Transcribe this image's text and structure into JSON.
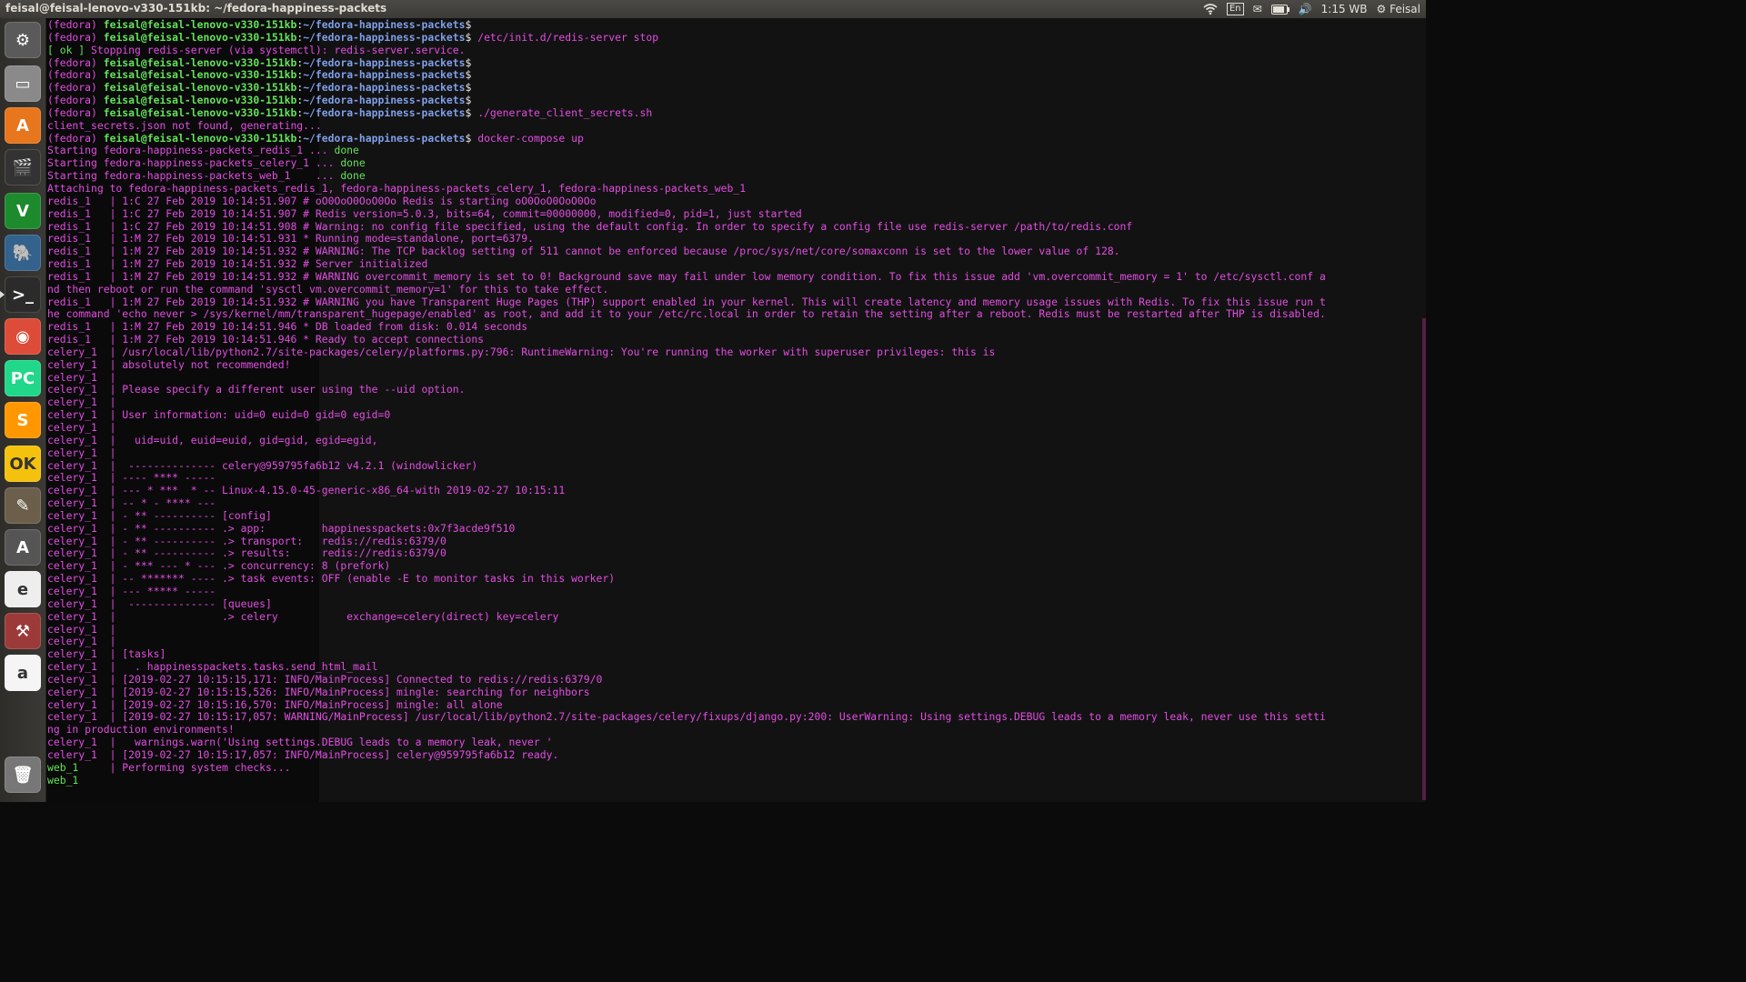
{
  "window_title": "feisal@feisal-lenovo-v330-151kb: ~/fedora-happiness-packets",
  "indicators": {
    "lang": "En",
    "clock": "1:15 WB",
    "user": "Feisal"
  },
  "launcher": [
    {
      "name": "system-settings-icon",
      "glyph": "⚙",
      "bg": "#5a5a5a"
    },
    {
      "name": "files-icon",
      "glyph": "▭",
      "bg": "#8a8a8a"
    },
    {
      "name": "software-center-icon",
      "glyph": "A",
      "bg": "#e8761d"
    },
    {
      "name": "video-editor-icon",
      "glyph": "🎬",
      "bg": "#333333"
    },
    {
      "name": "vim-icon",
      "glyph": "V",
      "bg": "#1e8a2e"
    },
    {
      "name": "postgres-icon",
      "glyph": "🐘",
      "bg": "#33628c"
    },
    {
      "name": "terminal-icon",
      "glyph": ">_",
      "bg": "#2b2b2b",
      "active": true
    },
    {
      "name": "chrome-icon",
      "glyph": "◉",
      "bg": "#dd4b39"
    },
    {
      "name": "pycharm-icon",
      "glyph": "PC",
      "bg": "#21d789"
    },
    {
      "name": "sublime-icon",
      "glyph": "S",
      "bg": "#ff9800"
    },
    {
      "name": "badge-app-icon",
      "glyph": "OK",
      "bg": "#f4c20d"
    },
    {
      "name": "gimp-icon",
      "glyph": "✎",
      "bg": "#6b5e4b"
    },
    {
      "name": "update-manager-icon",
      "glyph": "A",
      "bg": "#555555"
    },
    {
      "name": "email-icon",
      "glyph": "e",
      "bg": "#eeeeee"
    },
    {
      "name": "tools-icon",
      "glyph": "⚒",
      "bg": "#9c3a3a"
    },
    {
      "name": "amazon-icon",
      "glyph": "a",
      "bg": "#f5f5f5"
    },
    {
      "name": "trash-icon",
      "glyph": "🗑",
      "bg": "#777777"
    }
  ],
  "prompt": {
    "env": "(fedora) ",
    "user": "feisal@feisal-lenovo-v330-151kb",
    "sep": ":",
    "path": "~/fedora-happiness-packets",
    "sym": "$ "
  },
  "lines": [
    {
      "t": "prompt",
      "cmd": ""
    },
    {
      "t": "prompt",
      "cmd": "/etc/init.d/redis-server stop"
    },
    {
      "t": "text",
      "parts": [
        [
          "ok",
          "[ ok ]"
        ],
        [
          "red",
          " Stopping redis-server (via systemctl): redis-server.service."
        ]
      ]
    },
    {
      "t": "prompt",
      "cmd": ""
    },
    {
      "t": "prompt",
      "cmd": ""
    },
    {
      "t": "prompt",
      "cmd": ""
    },
    {
      "t": "prompt",
      "cmd": ""
    },
    {
      "t": "prompt",
      "cmd": "./generate_client_secrets.sh"
    },
    {
      "t": "text",
      "parts": [
        [
          "red",
          "client_secrets.json not found, generating..."
        ]
      ]
    },
    {
      "t": "prompt",
      "cmd": "docker-compose up"
    },
    {
      "t": "text",
      "parts": [
        [
          "red",
          "Starting fedora-happiness-packets_redis_1 ... "
        ],
        [
          "done",
          "done"
        ]
      ]
    },
    {
      "t": "text",
      "parts": [
        [
          "red",
          "Starting fedora-happiness-packets_celery_1 ... "
        ],
        [
          "done",
          "done"
        ]
      ]
    },
    {
      "t": "text",
      "parts": [
        [
          "red",
          "Starting fedora-happiness-packets_web_1    ... "
        ],
        [
          "done",
          "done"
        ]
      ]
    },
    {
      "t": "text",
      "parts": [
        [
          "red",
          "Attaching to fedora-happiness-packets_redis_1, fedora-happiness-packets_celery_1, fedora-happiness-packets_web_1"
        ]
      ]
    },
    {
      "t": "text",
      "parts": [
        [
          "red",
          "redis_1   | 1:C 27 Feb 2019 10:14:51.907 # oO0OoO0OoO0Oo Redis is starting oO0OoO0OoO0Oo"
        ]
      ]
    },
    {
      "t": "text",
      "parts": [
        [
          "red",
          "redis_1   | 1:C 27 Feb 2019 10:14:51.907 # Redis version=5.0.3, bits=64, commit=00000000, modified=0, pid=1, just started"
        ]
      ]
    },
    {
      "t": "text",
      "parts": [
        [
          "red",
          "redis_1   | 1:C 27 Feb 2019 10:14:51.908 # Warning: no config file specified, using the default config. In order to specify a config file use redis-server /path/to/redis.conf"
        ]
      ]
    },
    {
      "t": "text",
      "parts": [
        [
          "red",
          "redis_1   | 1:M 27 Feb 2019 10:14:51.931 * Running mode=standalone, port=6379."
        ]
      ]
    },
    {
      "t": "text",
      "parts": [
        [
          "red",
          "redis_1   | 1:M 27 Feb 2019 10:14:51.932 # WARNING: The TCP backlog setting of 511 cannot be enforced because /proc/sys/net/core/somaxconn is set to the lower value of 128."
        ]
      ]
    },
    {
      "t": "text",
      "parts": [
        [
          "red",
          "redis_1   | 1:M 27 Feb 2019 10:14:51.932 # Server initialized"
        ]
      ]
    },
    {
      "t": "text",
      "parts": [
        [
          "red",
          "redis_1   | 1:M 27 Feb 2019 10:14:51.932 # WARNING overcommit_memory is set to 0! Background save may fail under low memory condition. To fix this issue add 'vm.overcommit_memory = 1' to /etc/sysctl.conf a"
        ]
      ]
    },
    {
      "t": "text",
      "parts": [
        [
          "red",
          "nd then reboot or run the command 'sysctl vm.overcommit_memory=1' for this to take effect."
        ]
      ]
    },
    {
      "t": "text",
      "parts": [
        [
          "red",
          "redis_1   | 1:M 27 Feb 2019 10:14:51.932 # WARNING you have Transparent Huge Pages (THP) support enabled in your kernel. This will create latency and memory usage issues with Redis. To fix this issue run t"
        ]
      ]
    },
    {
      "t": "text",
      "parts": [
        [
          "red",
          "he command 'echo never > /sys/kernel/mm/transparent_hugepage/enabled' as root, and add it to your /etc/rc.local in order to retain the setting after a reboot. Redis must be restarted after THP is disabled."
        ]
      ]
    },
    {
      "t": "text",
      "parts": [
        [
          "red",
          "redis_1   | 1:M 27 Feb 2019 10:14:51.946 * DB loaded from disk: 0.014 seconds"
        ]
      ]
    },
    {
      "t": "text",
      "parts": [
        [
          "red",
          "redis_1   | 1:M 27 Feb 2019 10:14:51.946 * Ready to accept connections"
        ]
      ]
    },
    {
      "t": "text",
      "parts": [
        [
          "red",
          "celery_1  | /usr/local/lib/python2.7/site-packages/celery/platforms.py:796: RuntimeWarning: You're running the worker with superuser privileges: this is"
        ]
      ]
    },
    {
      "t": "text",
      "parts": [
        [
          "red",
          "celery_1  | absolutely not recommended!"
        ]
      ]
    },
    {
      "t": "text",
      "parts": [
        [
          "red",
          "celery_1  | "
        ]
      ]
    },
    {
      "t": "text",
      "parts": [
        [
          "red",
          "celery_1  | Please specify a different user using the --uid option."
        ]
      ]
    },
    {
      "t": "text",
      "parts": [
        [
          "red",
          "celery_1  | "
        ]
      ]
    },
    {
      "t": "text",
      "parts": [
        [
          "red",
          "celery_1  | User information: uid=0 euid=0 gid=0 egid=0"
        ]
      ]
    },
    {
      "t": "text",
      "parts": [
        [
          "red",
          "celery_1  | "
        ]
      ]
    },
    {
      "t": "text",
      "parts": [
        [
          "red",
          "celery_1  |   uid=uid, euid=euid, gid=gid, egid=egid,"
        ]
      ]
    },
    {
      "t": "text",
      "parts": [
        [
          "red",
          "celery_1  | "
        ]
      ]
    },
    {
      "t": "text",
      "parts": [
        [
          "red",
          "celery_1  |  -------------- celery@959795fa6b12 v4.2.1 (windowlicker)"
        ]
      ]
    },
    {
      "t": "text",
      "parts": [
        [
          "red",
          "celery_1  | ---- **** ----- "
        ]
      ]
    },
    {
      "t": "text",
      "parts": [
        [
          "red",
          "celery_1  | --- * ***  * -- Linux-4.15.0-45-generic-x86_64-with 2019-02-27 10:15:11"
        ]
      ]
    },
    {
      "t": "text",
      "parts": [
        [
          "red",
          "celery_1  | -- * - **** --- "
        ]
      ]
    },
    {
      "t": "text",
      "parts": [
        [
          "red",
          "celery_1  | - ** ---------- [config]"
        ]
      ]
    },
    {
      "t": "text",
      "parts": [
        [
          "red",
          "celery_1  | - ** ---------- .> app:         happinesspackets:0x7f3acde9f510"
        ]
      ]
    },
    {
      "t": "text",
      "parts": [
        [
          "red",
          "celery_1  | - ** ---------- .> transport:   redis://redis:6379/0"
        ]
      ]
    },
    {
      "t": "text",
      "parts": [
        [
          "red",
          "celery_1  | - ** ---------- .> results:     redis://redis:6379/0"
        ]
      ]
    },
    {
      "t": "text",
      "parts": [
        [
          "red",
          "celery_1  | - *** --- * --- .> concurrency: 8 (prefork)"
        ]
      ]
    },
    {
      "t": "text",
      "parts": [
        [
          "red",
          "celery_1  | -- ******* ---- .> task events: OFF (enable -E to monitor tasks in this worker)"
        ]
      ]
    },
    {
      "t": "text",
      "parts": [
        [
          "red",
          "celery_1  | --- ***** ----- "
        ]
      ]
    },
    {
      "t": "text",
      "parts": [
        [
          "red",
          "celery_1  |  -------------- [queues]"
        ]
      ]
    },
    {
      "t": "text",
      "parts": [
        [
          "red",
          "celery_1  |                 .> celery           exchange=celery(direct) key=celery"
        ]
      ]
    },
    {
      "t": "text",
      "parts": [
        [
          "red",
          "celery_1  |                 "
        ]
      ]
    },
    {
      "t": "text",
      "parts": [
        [
          "red",
          "celery_1  | "
        ]
      ]
    },
    {
      "t": "text",
      "parts": [
        [
          "red",
          "celery_1  | [tasks]"
        ]
      ]
    },
    {
      "t": "text",
      "parts": [
        [
          "red",
          "celery_1  |   . happinesspackets.tasks.send_html_mail"
        ]
      ]
    },
    {
      "t": "text",
      "parts": [
        [
          "red",
          "celery_1  | [2019-02-27 10:15:15,171: INFO/MainProcess] Connected to redis://redis:6379/0"
        ]
      ]
    },
    {
      "t": "text",
      "parts": [
        [
          "red",
          "celery_1  | [2019-02-27 10:15:15,526: INFO/MainProcess] mingle: searching for neighbors"
        ]
      ]
    },
    {
      "t": "text",
      "parts": [
        [
          "red",
          "celery_1  | [2019-02-27 10:15:16,570: INFO/MainProcess] mingle: all alone"
        ]
      ]
    },
    {
      "t": "text",
      "parts": [
        [
          "red",
          "celery_1  | [2019-02-27 10:15:17,057: WARNING/MainProcess] /usr/local/lib/python2.7/site-packages/celery/fixups/django.py:200: UserWarning: Using settings.DEBUG leads to a memory leak, never use this setti"
        ]
      ]
    },
    {
      "t": "text",
      "parts": [
        [
          "red",
          "ng in production environments!"
        ]
      ]
    },
    {
      "t": "text",
      "parts": [
        [
          "red",
          "celery_1  |   warnings.warn('Using settings.DEBUG leads to a memory leak, never '"
        ]
      ]
    },
    {
      "t": "text",
      "parts": [
        [
          "red",
          "celery_1  | [2019-02-27 10:15:17,057: INFO/MainProcess] celery@959795fa6b12 ready."
        ]
      ]
    },
    {
      "t": "text",
      "parts": [
        [
          "green",
          "web_1     "
        ],
        [
          "red",
          "| Performing system checks..."
        ]
      ]
    },
    {
      "t": "text",
      "parts": [
        [
          "green",
          "web_1     "
        ]
      ]
    }
  ]
}
